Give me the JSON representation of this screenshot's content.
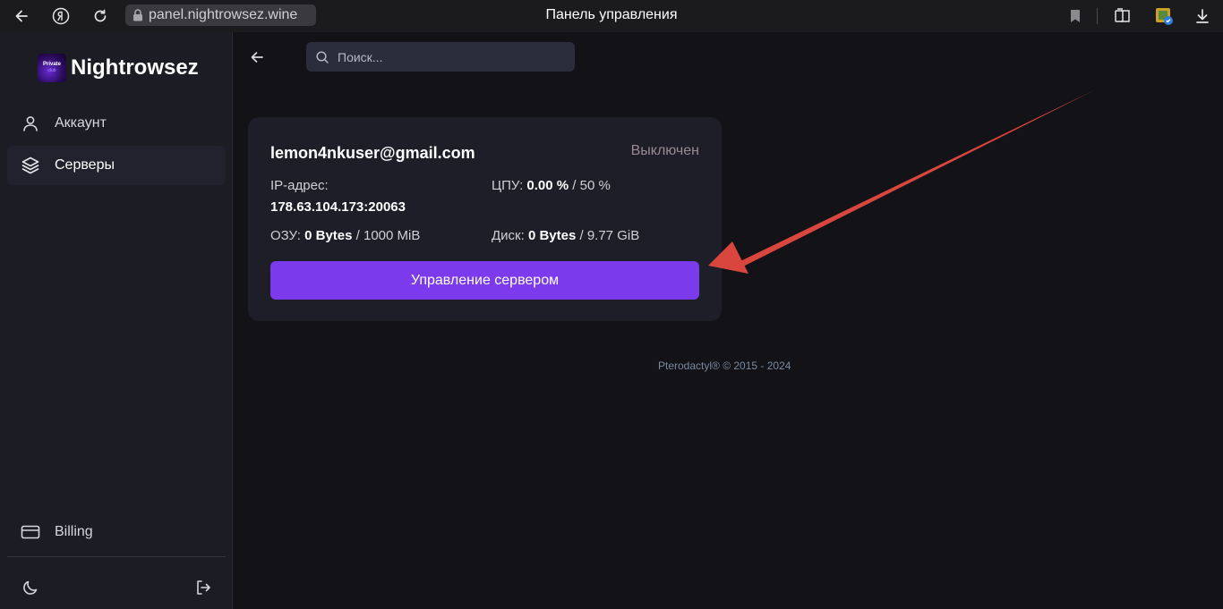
{
  "browser": {
    "url": "panel.nightrowsez.wine",
    "title": "Панель управления"
  },
  "sidebar": {
    "brand_name": "Nightrowsez",
    "logo_text_top": "Private",
    "logo_text_bottom": "club",
    "items": [
      {
        "label": "Аккаунт",
        "icon": "user-icon",
        "active": false
      },
      {
        "label": "Серверы",
        "icon": "layers-icon",
        "active": true
      },
      {
        "label": "Billing",
        "icon": "credit-card-icon",
        "active": false
      }
    ]
  },
  "search": {
    "placeholder": "Поиск..."
  },
  "server": {
    "name": "lemon4nkuser@gmail.com",
    "status": "Выключен",
    "ip_label": "IP-адрес:",
    "ip_value": "178.63.104.173:20063",
    "cpu_label": "ЦПУ:",
    "cpu_value": "0.00 %",
    "cpu_limit": "/ 50 %",
    "ram_label": "ОЗУ:",
    "ram_value": "0 Bytes",
    "ram_limit": "/ 1000 MiB",
    "disk_label": "Диск:",
    "disk_value": "0 Bytes",
    "disk_limit": "/ 9.77 GiB",
    "manage_label": "Управление сервером"
  },
  "footer": {
    "text": "Pterodactyl® © 2015 - 2024"
  },
  "colors": {
    "accent": "#7c3aed",
    "annotation_arrow": "#d9463e"
  }
}
